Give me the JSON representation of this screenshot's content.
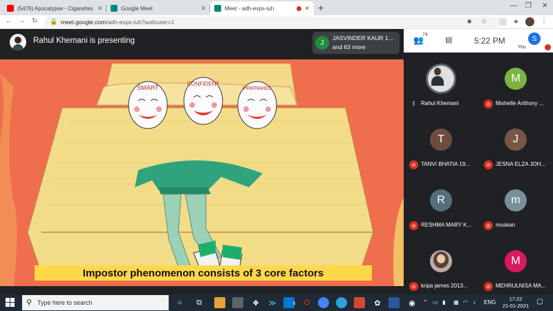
{
  "browser": {
    "tabs": [
      {
        "label": "(5476) Apocalypse - Cigarettes A",
        "favicon": "youtube-icon",
        "active": false
      },
      {
        "label": "Google Meet",
        "favicon": "meet-icon",
        "active": false
      },
      {
        "label": "Meet - adh-evps-iuh",
        "favicon": "meet-icon",
        "active": true
      }
    ],
    "new_tab": "+",
    "url_host": "meet.google.com",
    "url_path": "/adh-evps-iuh?authuser=1"
  },
  "meet": {
    "presenter_text": "Rahul Khemani is presenting",
    "joined": {
      "initial": "J",
      "name": "JASVINDER KAUR 1...",
      "more": "and 63 more"
    },
    "participant_count": "74",
    "clock": "5:22 PM",
    "self_initial": "S",
    "you_label": "You",
    "slide": {
      "caption": "Impostor phenomenon consists of 3 core factors",
      "masks": [
        "SMART",
        "CONFIDENT",
        "PREPARED"
      ]
    },
    "participants": [
      {
        "name": "Rahul Khemani",
        "initial": "",
        "color": "#e0e0e0",
        "mic": "on",
        "photo": "rahul"
      },
      {
        "name": "Mishelle Anthony ...",
        "initial": "M",
        "color": "#7cb342",
        "mic": "off",
        "photo": ""
      },
      {
        "name": "TANVI BHATIA 19...",
        "initial": "T",
        "color": "#6d4c41",
        "mic": "off",
        "photo": ""
      },
      {
        "name": "JESNA ELZA JOH...",
        "initial": "J",
        "color": "#795548",
        "mic": "off",
        "photo": ""
      },
      {
        "name": "RESHMA MARY K...",
        "initial": "R",
        "color": "#546e7a",
        "mic": "off",
        "photo": ""
      },
      {
        "name": "muskan",
        "initial": "m",
        "color": "#78909c",
        "mic": "off",
        "photo": ""
      },
      {
        "name": "kripa james 2013...",
        "initial": "",
        "color": "#bcaaa4",
        "mic": "off",
        "photo": "kripa"
      },
      {
        "name": "MEHRULNISA MA...",
        "initial": "M",
        "color": "#d81b60",
        "mic": "off",
        "photo": ""
      }
    ]
  },
  "taskbar": {
    "search_placeholder": "Type here to search",
    "lang": "ENG",
    "time": "17:22",
    "date": "21-01-2021",
    "mail_badge": "8"
  }
}
